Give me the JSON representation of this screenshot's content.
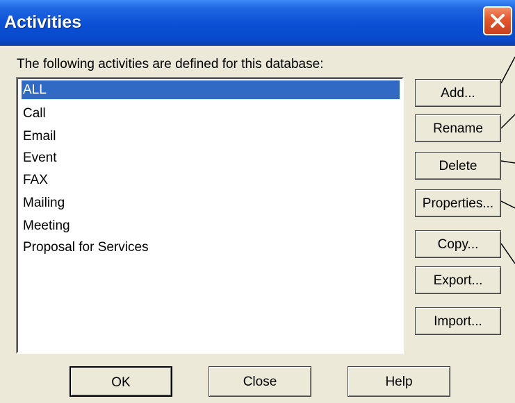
{
  "window": {
    "title": "Activities"
  },
  "description": "The following activities are defined for this database:",
  "activities": [
    {
      "label": "ALL",
      "selected": true
    },
    {
      "label": "Call",
      "selected": false
    },
    {
      "label": "Email",
      "selected": false
    },
    {
      "label": "Event",
      "selected": false
    },
    {
      "label": "FAX",
      "selected": false
    },
    {
      "label": "Mailing",
      "selected": false
    },
    {
      "label": "Meeting",
      "selected": false
    },
    {
      "label": "Proposal for Services",
      "selected": false
    }
  ],
  "side_buttons": {
    "add": "Add...",
    "rename": "Rename",
    "delete": "Delete",
    "properties": "Properties...",
    "copy": "Copy...",
    "export": "Export...",
    "import": "Import..."
  },
  "bottom_buttons": {
    "ok": "OK",
    "close": "Close",
    "help": "Help"
  },
  "colors": {
    "titlebar": "#0a4fd5",
    "selection": "#316ac5",
    "close_button": "#e45a2f",
    "dialog_background": "#ece9d8"
  },
  "icons": {
    "close": "close-x-icon"
  }
}
